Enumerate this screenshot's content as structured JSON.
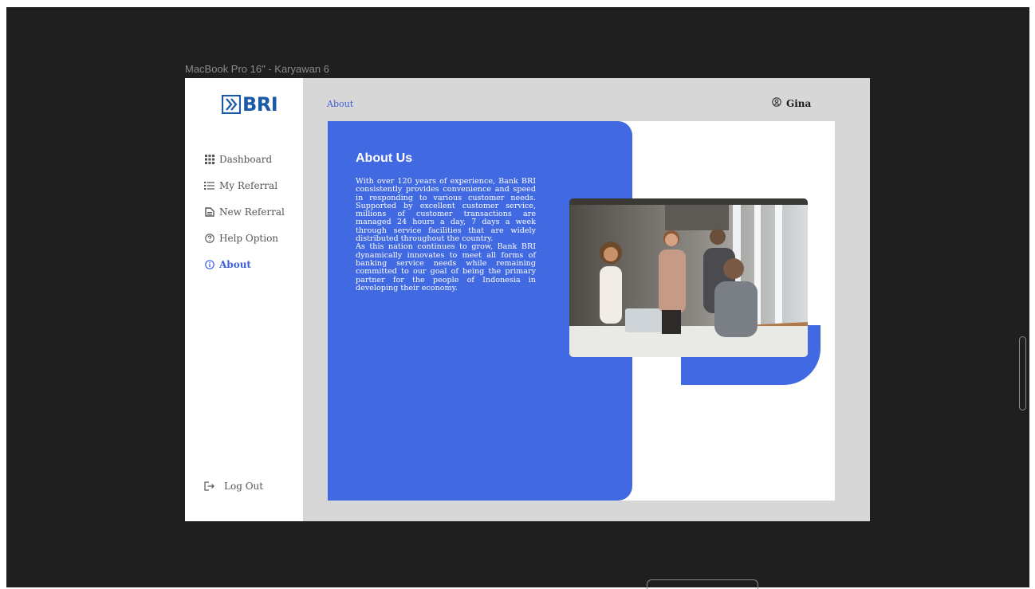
{
  "frame_label": "MacBook Pro 16\" - Karyawan 6",
  "logo_text": "BRI",
  "nav": {
    "dashboard": "Dashboard",
    "my_referral": "My Referral",
    "new_referral": "New Referral",
    "help_option": "Help Option",
    "about": "About",
    "logout": "Log Out"
  },
  "breadcrumb": "About",
  "user_name": "Gina",
  "about": {
    "title": "About Us",
    "paragraph1": "With over 120 years of experience, Bank BRI consistently provides convenience and speed in responding to various customer needs. Supported by excellent customer service, millions of customer transactions are managed 24 hours a day, 7 days a week through service facilities that are widely distributed throughout the country.",
    "paragraph2": "As this nation continues to grow, Bank BRI dynamically innovates to meet all forms of banking service needs while remaining committed to our goal of being the primary partner for the people of Indonesia in developing their economy."
  },
  "icons": {
    "dashboard": "grid-icon",
    "my_referral": "list-icon",
    "new_referral": "document-icon",
    "help_option": "help-circle-icon",
    "about": "info-circle-icon",
    "logout": "logout-icon",
    "user": "user-avatar-icon"
  },
  "colors": {
    "accent": "#4169e1",
    "brand": "#1a5aa8",
    "frame_bg": "#d7d7d7",
    "canvas_bg": "#1f1f1f"
  }
}
